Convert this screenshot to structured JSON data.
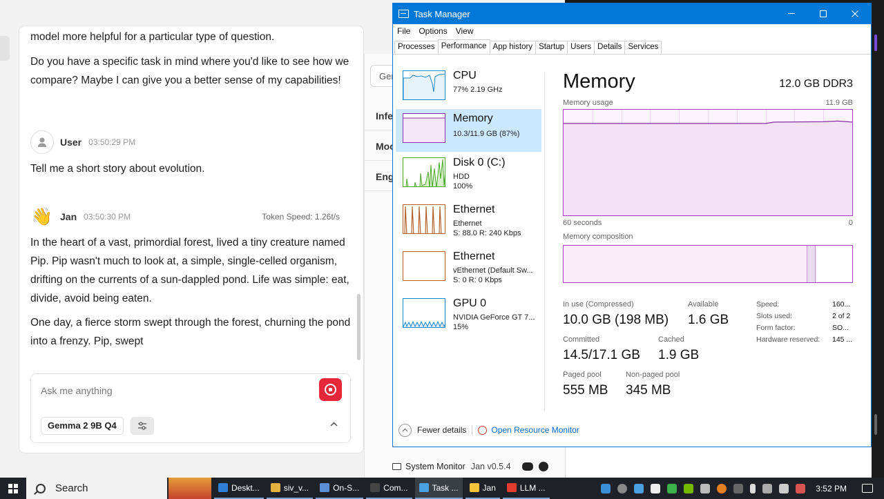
{
  "jan": {
    "messages": [
      {
        "text": "model more helpful for a particular type of question."
      },
      {
        "text": "Do you have a specific task in mind where you'd like to see how we compare? Maybe I can give you a better sense of my capabilities!"
      }
    ],
    "user_msg": {
      "name": "User",
      "time": "03:50:29 PM",
      "text": "Tell me a short story about evolution."
    },
    "bot_msg": {
      "name": "Jan",
      "time": "03:50:30 PM",
      "token_speed": "Token Speed: 1.26t/s",
      "p1": "In the heart of a vast, primordial forest, lived a tiny creature named Pip. Pip wasn't much to look at, a simple, single-celled organism, drifting on the currents of a sun-dappled pond. Life was simple: eat, divide, avoid being eaten.",
      "p2": "One day, a fierce storm swept through the forest, churning the pond into a frenzy. Pip, swept"
    },
    "input": {
      "placeholder": "Ask me anything",
      "model": "Gemma 2 9B Q4"
    },
    "mid_panel": {
      "select_partial": "Ger",
      "rows": [
        "Infe",
        "Moc",
        "Eng"
      ]
    },
    "status": {
      "monitor": "System Monitor",
      "version": "Jan v0.5.4"
    }
  },
  "tm": {
    "title": "Task Manager",
    "menu": [
      "File",
      "Options",
      "View"
    ],
    "tabs": [
      "Processes",
      "Performance",
      "App history",
      "Startup",
      "Users",
      "Details",
      "Services"
    ],
    "active_tab": "Performance",
    "sidebar": [
      {
        "title": "CPU",
        "sub1": "77%  2.19 GHz",
        "sub2": "",
        "sub3": "",
        "color": "#1a86c7"
      },
      {
        "title": "Memory",
        "sub1": "10.3/11.9 GB (87%)",
        "sub2": "",
        "sub3": "",
        "color": "#8b2fa6"
      },
      {
        "title": "Disk 0 (C:)",
        "sub1": "HDD",
        "sub2": "100%",
        "sub3": "",
        "color": "#4da62a"
      },
      {
        "title": "Ethernet",
        "sub1": "Ethernet",
        "sub2": "S: 88.0  R: 240 Kbps",
        "sub3": "",
        "color": "#b5602b"
      },
      {
        "title": "Ethernet",
        "sub1": "vEthernet (Default Sw...",
        "sub2": "S: 0  R: 0 Kbps",
        "sub3": "",
        "color": "#b5602b"
      },
      {
        "title": "GPU 0",
        "sub1": "NVIDIA GeForce GT 7...",
        "sub2": "15%",
        "sub3": "",
        "color": "#1a86c7"
      }
    ],
    "memory": {
      "title": "Memory",
      "type": "12.0 GB DDR3",
      "usage_label": "Memory usage",
      "usage_max": "11.9 GB",
      "time_left": "60 seconds",
      "time_right": "0",
      "composition_label": "Memory composition",
      "usage_fraction": 0.87,
      "stats": [
        {
          "label": "In use (Compressed)",
          "value": "10.0 GB (198 MB)"
        },
        {
          "label": "Available",
          "value": "1.6 GB"
        },
        {
          "label": "Committed",
          "value": "14.5/17.1 GB"
        },
        {
          "label": "Cached",
          "value": "1.9 GB"
        },
        {
          "label": "Paged pool",
          "value": "555 MB"
        },
        {
          "label": "Non-paged pool",
          "value": "345 MB"
        }
      ],
      "kv": [
        {
          "label": "Speed:",
          "value": "160..."
        },
        {
          "label": "Slots used:",
          "value": "2 of 2"
        },
        {
          "label": "Form factor:",
          "value": "SO..."
        },
        {
          "label": "Hardware reserved:",
          "value": "145 ..."
        }
      ]
    },
    "footer": {
      "fewer": "Fewer details",
      "resmon": "Open Resource Monitor"
    }
  },
  "taskbar": {
    "search": "Search",
    "apps": [
      {
        "label": "Deskt...",
        "color": "#2f7fd6",
        "active": false
      },
      {
        "label": "siv_v...",
        "color": "#e3b341",
        "active": false
      },
      {
        "label": "On-S...",
        "color": "#5a8fd6",
        "active": false
      },
      {
        "label": "Com...",
        "color": "#444444",
        "active": false
      },
      {
        "label": "Task ...",
        "color": "#4aa0e0",
        "active": true
      },
      {
        "label": "Jan",
        "color": "#f3c13a",
        "active": false
      },
      {
        "label": "LLM ...",
        "color": "#e33b2e",
        "active": false
      }
    ],
    "time": "3:52 PM"
  }
}
